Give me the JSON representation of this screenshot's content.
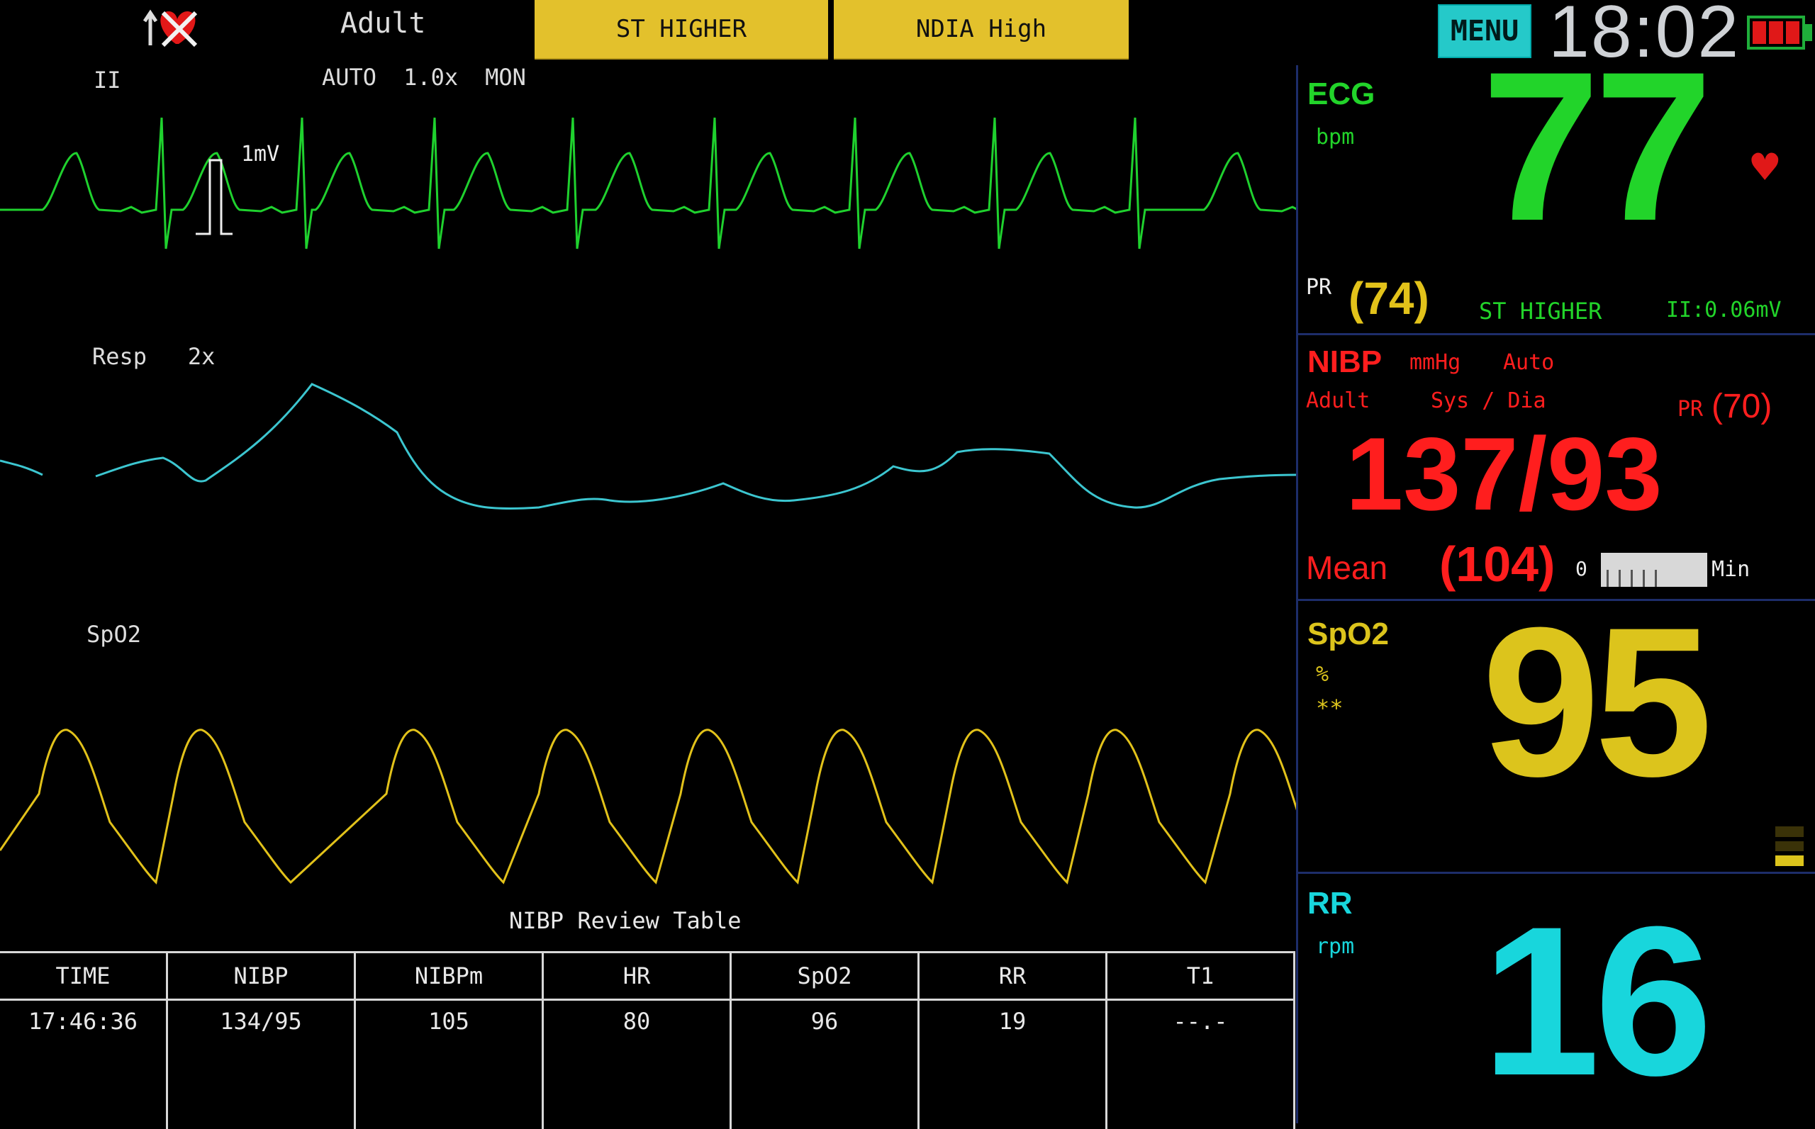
{
  "header": {
    "patient_type": "Adult",
    "alarms": [
      "ST HIGHER",
      "NDIA High"
    ],
    "menu_label": "MENU",
    "time": "18:02",
    "icons": [
      "alarm-off-icon",
      "battery-icon"
    ]
  },
  "ecg_wave": {
    "lead": "II",
    "settings": [
      "AUTO",
      "1.0x",
      "MON"
    ],
    "cal_label": "1mV",
    "color": "#1fd12e"
  },
  "resp_wave": {
    "label": "Resp",
    "gain": "2x",
    "color": "#3cc6d0"
  },
  "spo2_wave": {
    "label": "SpO2",
    "color": "#e2c21a"
  },
  "ecg_panel": {
    "title": "ECG",
    "unit": "bpm",
    "value": "77",
    "pr_label": "PR",
    "pr_value": "(74)",
    "st_alarm": "ST HIGHER",
    "st_value": "II:0.06mV",
    "color": "#22d42a"
  },
  "nibp_panel": {
    "title": "NIBP",
    "unit": "mmHg",
    "mode": "Auto",
    "patient": "Adult",
    "sys_dia_label": "Sys / Dia",
    "pr_label": "PR",
    "pr_value": "(70)",
    "value": "137/93",
    "mean_label": "Mean",
    "mean_value": "(104)",
    "timer_start": "0",
    "timer_unit": "Min",
    "color": "#ff1e1e"
  },
  "spo2_panel": {
    "title": "SpO2",
    "unit": "%",
    "quality": "**",
    "value": "95",
    "color": "#dcc41c"
  },
  "rr_panel": {
    "title": "RR",
    "unit": "rpm",
    "value": "16",
    "color": "#18d6dc"
  },
  "review_table": {
    "title": "NIBP Review Table",
    "headers": [
      "TIME",
      "NIBP",
      "NIBPm",
      "HR",
      "SpO2",
      "RR",
      "T1"
    ],
    "rows": [
      [
        "17:46:36",
        "134/95",
        "105",
        "80",
        "96",
        "19",
        "--.-"
      ]
    ]
  }
}
